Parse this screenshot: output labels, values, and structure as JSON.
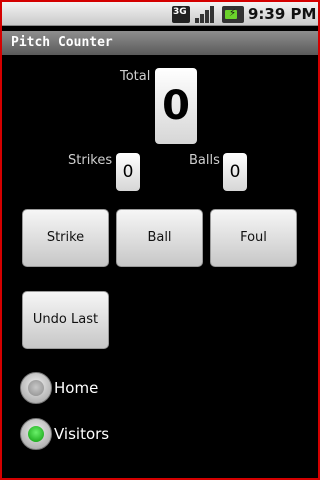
{
  "status_bar": {
    "network": "3G",
    "time": "9:39 PM",
    "icons": [
      "network-3g-icon",
      "signal-strength-icon",
      "battery-charging-icon"
    ]
  },
  "app": {
    "title": "Pitch Counter"
  },
  "counts": {
    "total_label": "Total",
    "total_value": "0",
    "strikes_label": "Strikes",
    "strikes_value": "0",
    "balls_label": "Balls",
    "balls_value": "0"
  },
  "buttons": {
    "strike": "Strike",
    "ball": "Ball",
    "foul": "Foul",
    "undo": "Undo Last"
  },
  "team": {
    "options": [
      {
        "label": "Home",
        "selected": false
      },
      {
        "label": "Visitors",
        "selected": true
      }
    ]
  },
  "colors": {
    "frame_border": "#d40000",
    "radio_selected": "#1fc21f",
    "background": "#000000"
  }
}
